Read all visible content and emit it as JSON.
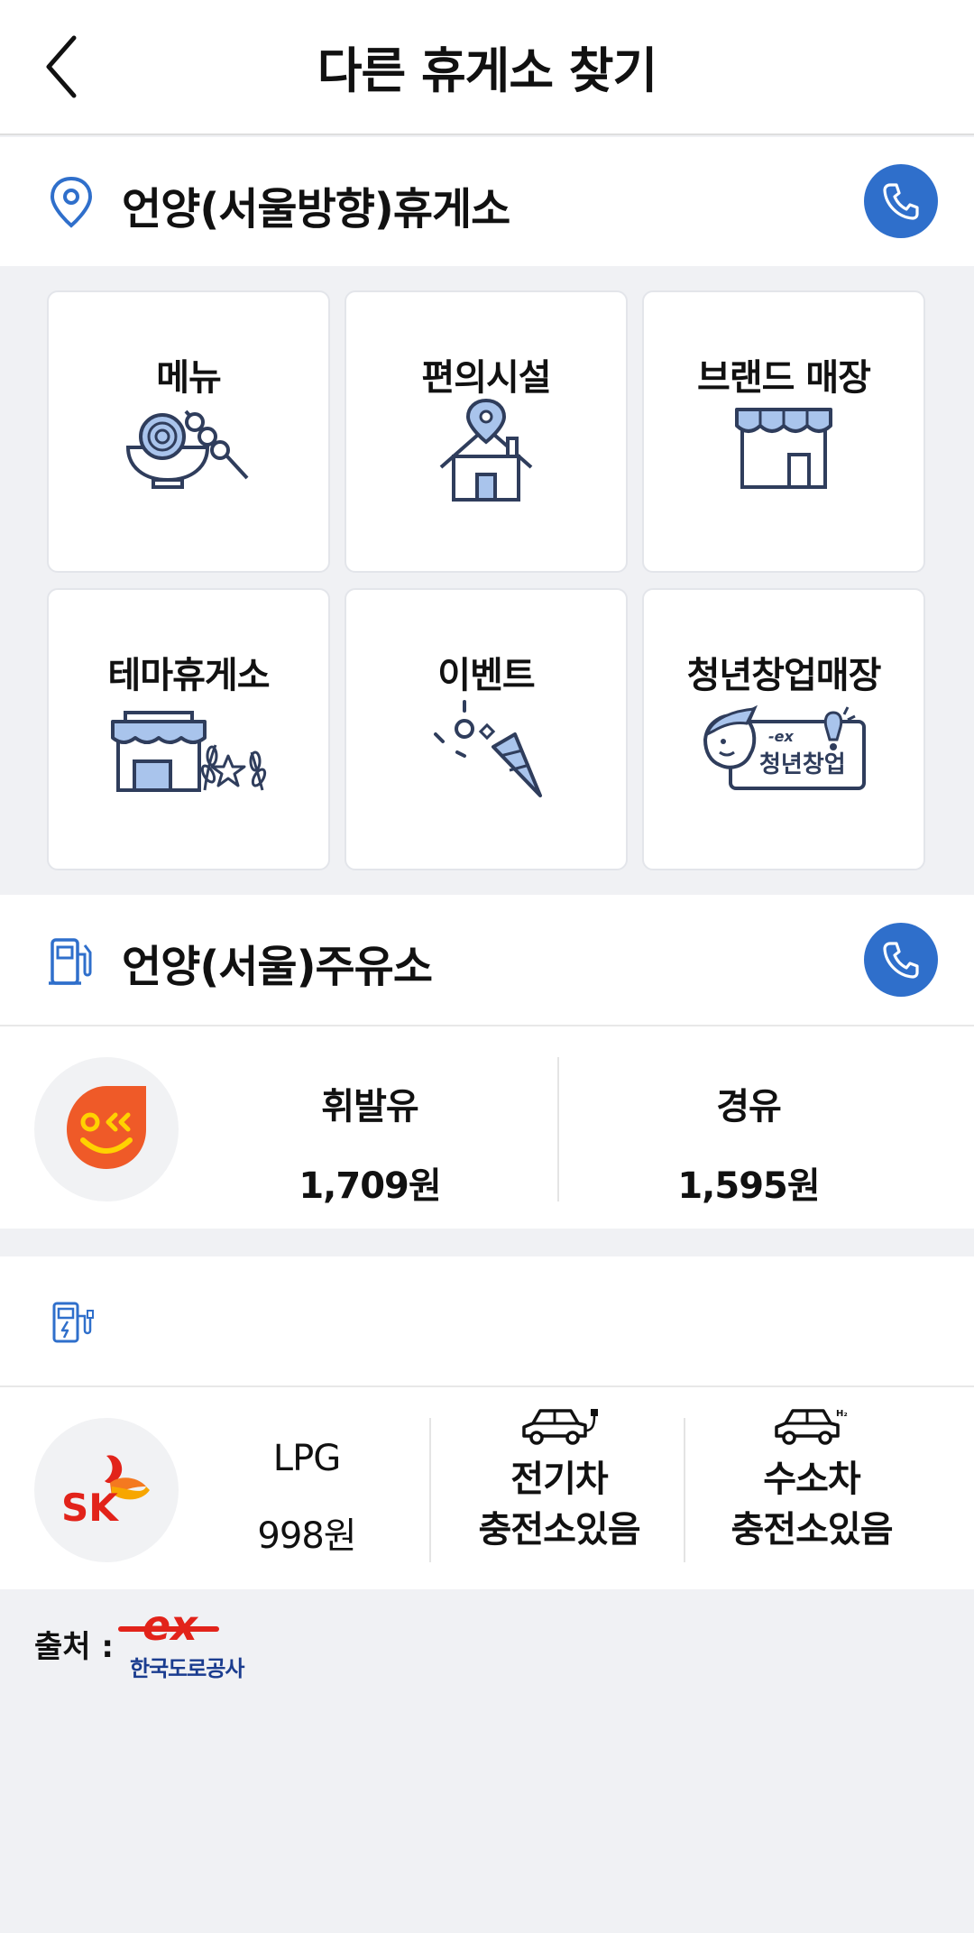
{
  "header": {
    "title": "다른 휴게소 찾기"
  },
  "rest_area": {
    "name": "언양(서울방향)휴게소",
    "menu": [
      {
        "label": "메뉴",
        "icon": "food-bowl-skewer-icon"
      },
      {
        "label": "편의시설",
        "icon": "house-pin-icon"
      },
      {
        "label": "브랜드 매장",
        "icon": "storefront-icon"
      },
      {
        "label": "테마휴게소",
        "icon": "themed-store-icon"
      },
      {
        "label": "이벤트",
        "icon": "party-popper-icon"
      },
      {
        "label": "청년창업매장",
        "icon": "youth-startup-icon"
      }
    ],
    "youth_badge_text": "청년창업"
  },
  "gas_station": {
    "name": "언양(서울)주유소",
    "brand_icon": "s-oil-logo",
    "gasoline": {
      "label": "휘발유",
      "price": "1,709원"
    },
    "diesel": {
      "label": "경유",
      "price": "1,595원"
    }
  },
  "ev_station": {
    "brand_icon": "sk-logo",
    "brand_text": "SK",
    "lpg": {
      "label": "LPG",
      "price": "998원"
    },
    "electric": {
      "line1": "전기차",
      "line2": "충전소있음",
      "icon": "electric-car-icon"
    },
    "hydrogen": {
      "line1": "수소차",
      "line2": "충전소있음",
      "icon": "hydrogen-car-icon",
      "h2": "H₂"
    }
  },
  "source": {
    "label": "출처 :",
    "org": "한국도로공사",
    "logo_text": "ex"
  },
  "colors": {
    "accent": "#2f6fcb",
    "icon_navy": "#2f3d5c",
    "icon_blue": "#a9c4ec",
    "soil_orange": "#ef5a28",
    "sk_red": "#e2231a"
  }
}
